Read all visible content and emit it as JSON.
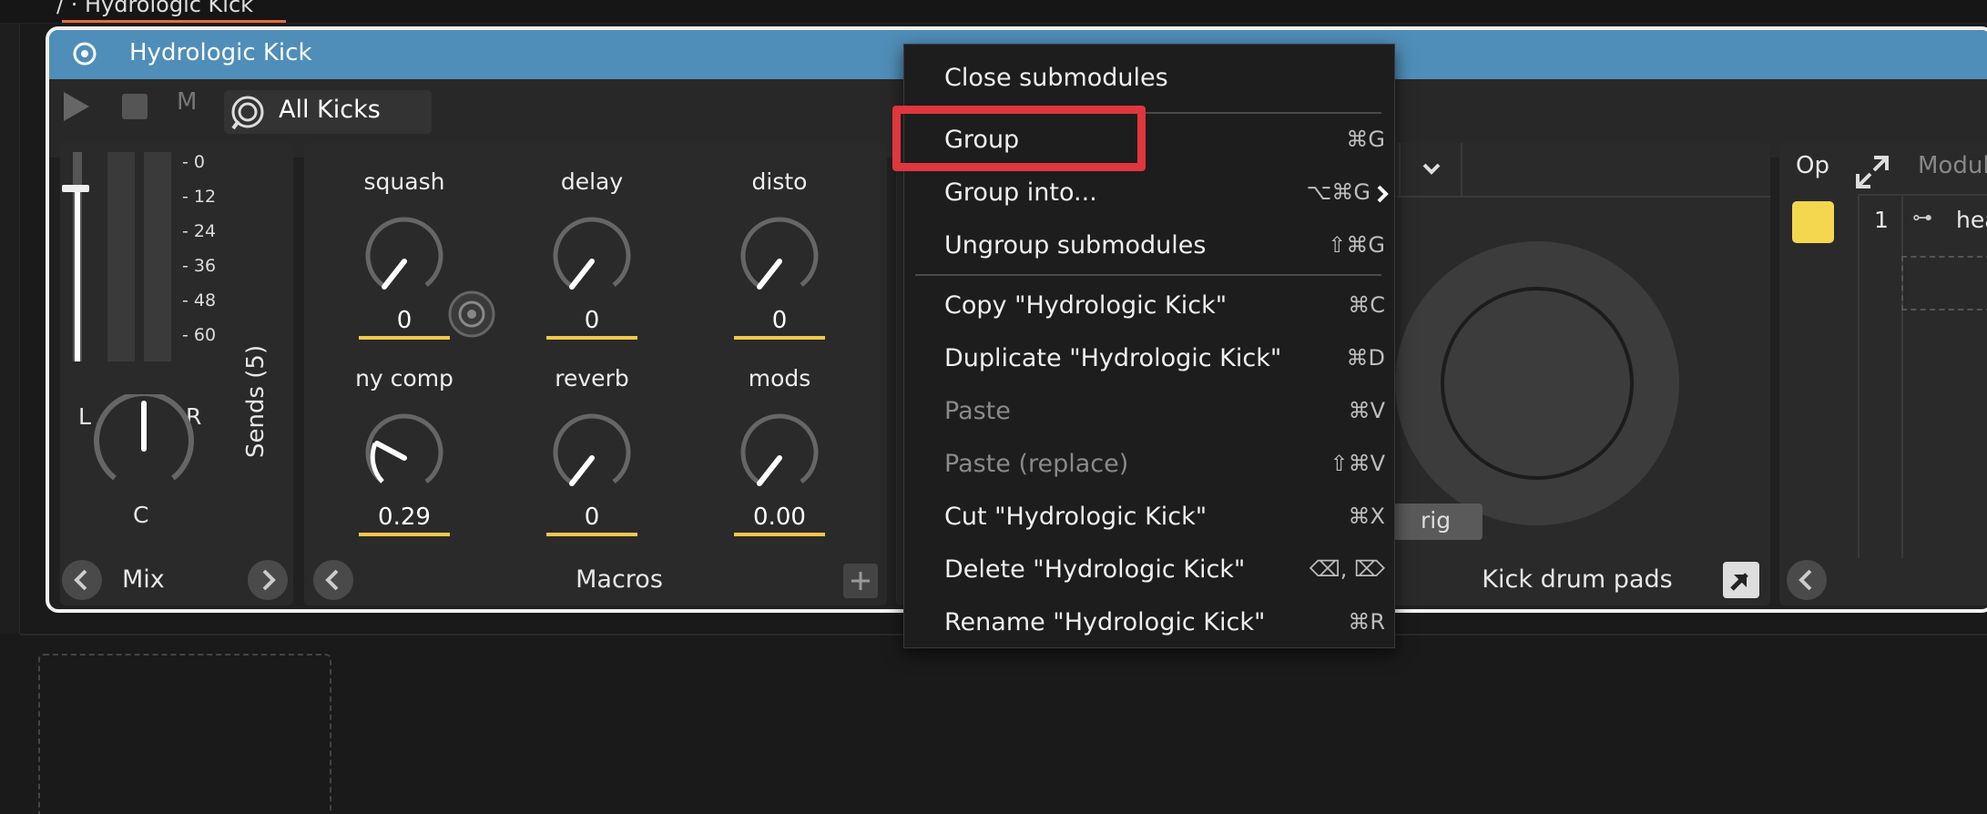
{
  "topbar": {
    "breadcrumb": "/ ·  Hydrologic Kick"
  },
  "device": {
    "title": "Hydrologic Kick",
    "transport": {
      "mute_label": "M",
      "preset": "All Kicks"
    },
    "mix": {
      "meter_ticks": [
        "0",
        "12",
        "24",
        "36",
        "48",
        "60"
      ],
      "pan_left": "L",
      "pan_right": "R",
      "pan_center": "C",
      "label": "Mix"
    },
    "sends": {
      "label": "Sends (5)"
    },
    "macros": {
      "label": "Macros",
      "knobs": [
        {
          "label": "squash",
          "value": "0"
        },
        {
          "label": "delay",
          "value": "0"
        },
        {
          "label": "disto",
          "value": "0"
        },
        {
          "label": "ny comp",
          "value": "0.29"
        },
        {
          "label": "reverb",
          "value": "0"
        },
        {
          "label": "mods",
          "value": "0.00"
        }
      ]
    },
    "pads": {
      "label": "Kick drum pads",
      "partial_label": "rig"
    },
    "right_panel": {
      "op_label": "Op",
      "module_header": "Modul",
      "row_number": "1",
      "row_text": "hea"
    }
  },
  "context_menu": {
    "items": [
      {
        "label": "Close submodules",
        "shortcut": ""
      },
      {
        "label": "Group",
        "shortcut": "⌘G"
      },
      {
        "label": "Group into...",
        "shortcut": "⌥⌘G"
      },
      {
        "label": "Ungroup submodules",
        "shortcut": "⇧⌘G"
      },
      {
        "label": "Copy \"Hydrologic Kick\"",
        "shortcut": "⌘C"
      },
      {
        "label": "Duplicate \"Hydrologic Kick\"",
        "shortcut": "⌘D"
      },
      {
        "label": "Paste",
        "shortcut": "⌘V"
      },
      {
        "label": "Paste (replace)",
        "shortcut": "⇧⌘V"
      },
      {
        "label": "Cut \"Hydrologic Kick\"",
        "shortcut": "⌘X"
      },
      {
        "label": "Delete \"Hydrologic Kick\"",
        "shortcut": "⌫, ⌦"
      },
      {
        "label": "Rename \"Hydrologic Kick\"",
        "shortcut": "⌘R"
      }
    ]
  },
  "colors": {
    "title_bar": "#4f8eb8",
    "macro_bar": "#f2c94c",
    "highlight": "#e0363d",
    "op_swatch": "#f5d64f"
  }
}
